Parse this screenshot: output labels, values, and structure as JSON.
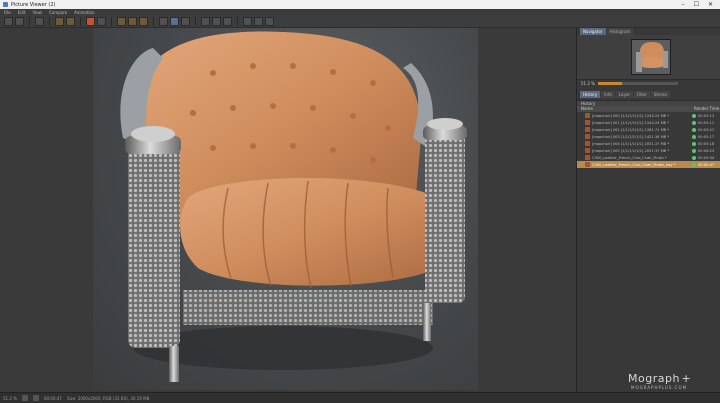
{
  "window": {
    "title": "Picture Viewer (2)",
    "controls": [
      "–",
      "☐",
      "✕"
    ]
  },
  "menu": [
    "File",
    "Edit",
    "View",
    "Compare",
    "Animation"
  ],
  "panel": {
    "tabs_top": [
      "Navigator",
      "Histogram"
    ],
    "zoom": "51.2 %",
    "zoom_fraction": 0.3,
    "tabs_bottom": [
      "History",
      "Info",
      "Layer",
      "Filter",
      "Stereo"
    ],
    "section_title": "History",
    "history_columns": [
      "Name",
      "Render Time"
    ],
    "history_rows": [
      {
        "name": "[mapchair] 000 [1/1/1/1/1/1] 1244.24 MB *",
        "time": "00:05:13"
      },
      {
        "name": "[mapchair] 001 [1/1/1/1/1/1] 1244.24 MB *",
        "time": "00:05:11"
      },
      {
        "name": "[mapchair] 002 [1/1/1/1/1/1] 1281.71 MB *",
        "time": "00:03:27"
      },
      {
        "name": "[mapchair] 003 [1/1/1/1/1/1] 1421.38 MB *",
        "time": "00:05:17"
      },
      {
        "name": "[mapchair] 004 [1/1/1/1/1/1] 2051.37 MB *",
        "time": "00:05:18"
      },
      {
        "name": "[mapchair] 005 [1/1/1/1/1/1] 2051.37 MB *",
        "time": "00:04:23"
      },
      {
        "name": "C300_Leather_French_Club_Chair_Finish *",
        "time": "00:09:34"
      },
      {
        "name": "C300_Leather_French_Club_Chair_Finish_Iray *",
        "time": "00:00:47",
        "selected": true
      }
    ]
  },
  "status": {
    "zoom": "51.2 %",
    "time": "00:00:47",
    "info": "Size: 2000x2000, RGB (32 Bit), 36.19 MB"
  },
  "watermark": {
    "brand": "Mograph",
    "plus": "+",
    "sub": "MOGRAPHPLUS.COM"
  }
}
